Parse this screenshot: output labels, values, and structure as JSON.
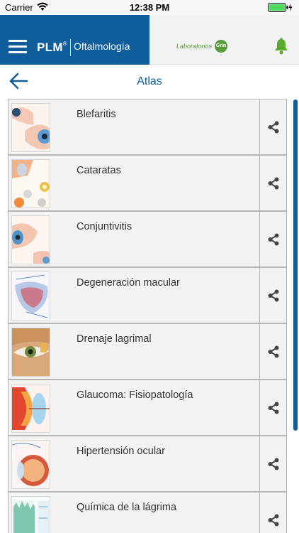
{
  "status_bar": {
    "carrier": "Carrier",
    "time": "12:38 PM"
  },
  "header": {
    "brand": "PLM",
    "brand_mark": "®",
    "section": "Oftalmología",
    "sponsor_text": "Laboratorios",
    "sponsor_badge": "Grin",
    "colors": {
      "primary": "#0f5d9b",
      "sponsor_green": "#5a9b3c"
    }
  },
  "page": {
    "title": "Atlas"
  },
  "atlas_items": [
    {
      "label": "Blefaritis",
      "thumb": "eye-illustration"
    },
    {
      "label": "Cataratas",
      "thumb": "lens-illustration"
    },
    {
      "label": "Conjuntivitis",
      "thumb": "eye-illustration"
    },
    {
      "label": "Degeneración macular",
      "thumb": "retina-illustration"
    },
    {
      "label": "Drenaje lagrimal",
      "thumb": "eye-photo"
    },
    {
      "label": "Glaucoma: Fisiopatología",
      "thumb": "eye-section-illustration"
    },
    {
      "label": "Hipertensión ocular",
      "thumb": "eye-section-illustration"
    },
    {
      "label": "Química de la lágrima",
      "thumb": "tear-chart-illustration"
    }
  ]
}
